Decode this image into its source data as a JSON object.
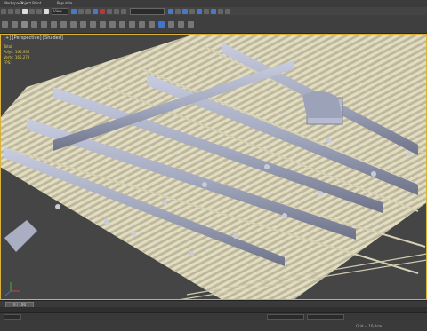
{
  "menubar": {
    "items": [
      "Workspace",
      "Object Paint",
      "Populate"
    ]
  },
  "toolbar": {
    "selection_filter": "View",
    "search_placeholder": ""
  },
  "viewport": {
    "label": "[+] [Perspective] [Shaded]"
  },
  "stats": {
    "title": "Total",
    "polys_label": "Polys:",
    "polys_value": "165,932",
    "verts_label": "Verts:",
    "verts_value": "166,273",
    "fps_label": "FPS:"
  },
  "timeline": {
    "frame": "0 / 100"
  },
  "statusbar": {
    "grid": "Grid = 10,0cm"
  },
  "colors": {
    "accent": "#d9b23a",
    "ducts": "#9aa0b4",
    "ceiling": "#d8d2b6",
    "background": "#454545"
  }
}
